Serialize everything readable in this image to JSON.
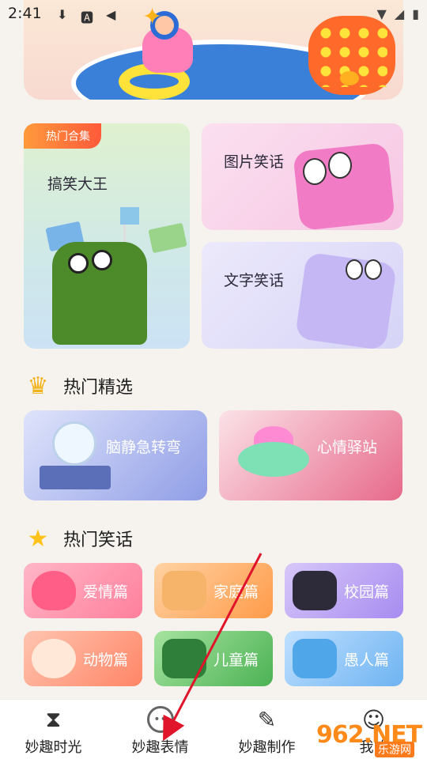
{
  "status_bar": {
    "time": "2:41",
    "left_icons": [
      "download-icon",
      "text-a-icon",
      "app-icon"
    ],
    "right_icons": [
      "wifi-icon",
      "signal-icon",
      "battery-icon"
    ]
  },
  "banner": {
    "image": "pool-party-illustration"
  },
  "featured": {
    "badge": "热门合集",
    "big_card_label": "搞笑大王",
    "image_jokes_label": "图片笑话",
    "text_jokes_label": "文字笑话"
  },
  "hot_picks": {
    "title": "热门精选",
    "icon": "crown-icon",
    "items": [
      {
        "label": "脑静急转弯",
        "art": "lightbulb-icon"
      },
      {
        "label": "心情驿站",
        "art": "ufo-icon"
      }
    ]
  },
  "hot_jokes": {
    "title": "热门笑话",
    "icon": "star-icon",
    "items": [
      {
        "label": "爱情篇",
        "art": "heart-icon"
      },
      {
        "label": "家庭篇",
        "art": "house-icon"
      },
      {
        "label": "校园篇",
        "art": "graduation-cap-icon"
      },
      {
        "label": "动物篇",
        "art": "cat-icon"
      },
      {
        "label": "儿童篇",
        "art": "bumper-car-icon"
      },
      {
        "label": "愚人篇",
        "art": "question-box-icon"
      }
    ]
  },
  "bottom_nav": {
    "items": [
      {
        "label": "妙趣时光",
        "icon": "hourglass-icon"
      },
      {
        "label": "妙趣表情",
        "icon": "emoji-icon"
      },
      {
        "label": "妙趣制作",
        "icon": "ruler-pencil-icon"
      },
      {
        "label": "我的",
        "icon": "user-icon"
      }
    ]
  },
  "watermark": {
    "logo": "962.NET",
    "sub": "乐游网"
  },
  "colors": {
    "background": "#f6f3ee",
    "badge": "#ff6a3a",
    "arrow": "#e0142a"
  }
}
